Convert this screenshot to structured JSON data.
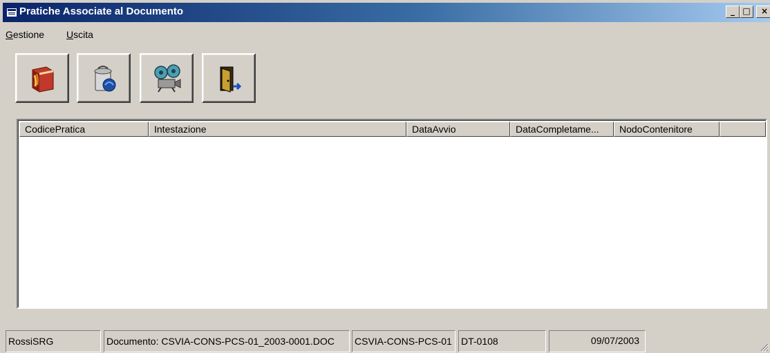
{
  "window": {
    "title": "Pratiche Associate al Documento",
    "controls": {
      "minimize": "_",
      "maximize": "□",
      "close": "×"
    }
  },
  "menu": {
    "items": [
      {
        "first": "G",
        "rest": "estione"
      },
      {
        "first": "U",
        "rest": "scita"
      }
    ]
  },
  "toolbar": {
    "buttons": [
      {
        "icon": "book-icon"
      },
      {
        "icon": "trash-can-icon"
      },
      {
        "icon": "film-projector-icon"
      },
      {
        "icon": "exit-door-icon"
      }
    ]
  },
  "list": {
    "columns": [
      "CodicePratica",
      "Intestazione",
      "DataAvvio",
      "DataCompletame...",
      "NodoContenitore",
      ""
    ],
    "rows": []
  },
  "status": {
    "user": "RossiSRG",
    "document": "Documento: CSVIA-CONS-PCS-01_2003-0001.DOC",
    "code": "CSVIA-CONS-PCS-01",
    "doc_type": "DT-0108",
    "empty": "",
    "date": "09/07/2003"
  },
  "colors": {
    "titlebar_start": "#0a246a",
    "titlebar_end": "#a6caf0",
    "face": "#d4d0c8"
  }
}
